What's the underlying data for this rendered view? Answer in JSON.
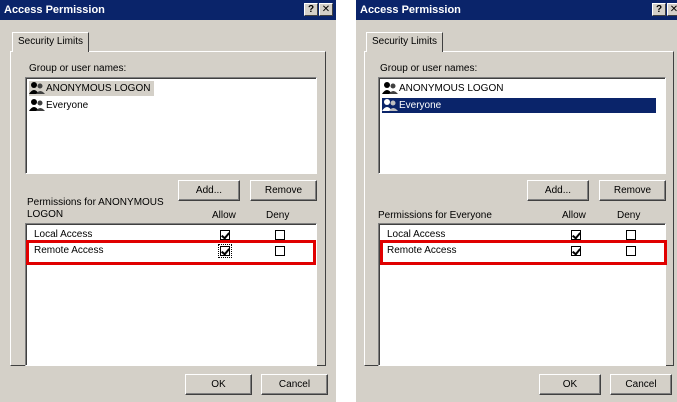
{
  "accent": {
    "titlebar": "#0a246a",
    "face": "#d4d0c8",
    "highlight": "#e00000"
  },
  "dialogs": [
    {
      "title": "Access Permission",
      "help_icon": "?",
      "close_icon": "✕",
      "tab": "Security Limits",
      "group_label": "Group or user names:",
      "users": [
        "ANONYMOUS LOGON",
        "Everyone"
      ],
      "selected_user": "ANONYMOUS LOGON",
      "add_label": "Add...",
      "remove_label": "Remove",
      "permissions_label": "Permissions for ANONYMOUS LOGON",
      "allow_label": "Allow",
      "deny_label": "Deny",
      "permissions": [
        {
          "name": "Local Access",
          "allow": true,
          "deny": false
        },
        {
          "name": "Remote Access",
          "allow": true,
          "deny": false
        }
      ],
      "ok_label": "OK",
      "cancel_label": "Cancel"
    },
    {
      "title": "Access Permission",
      "help_icon": "?",
      "close_icon": "✕",
      "tab": "Security Limits",
      "group_label": "Group or user names:",
      "users": [
        "ANONYMOUS LOGON",
        "Everyone"
      ],
      "selected_user": "Everyone",
      "add_label": "Add...",
      "remove_label": "Remove",
      "permissions_label": "Permissions for Everyone",
      "allow_label": "Allow",
      "deny_label": "Deny",
      "permissions": [
        {
          "name": "Local Access",
          "allow": true,
          "deny": false
        },
        {
          "name": "Remote Access",
          "allow": true,
          "deny": false
        }
      ],
      "ok_label": "OK",
      "cancel_label": "Cancel"
    }
  ]
}
